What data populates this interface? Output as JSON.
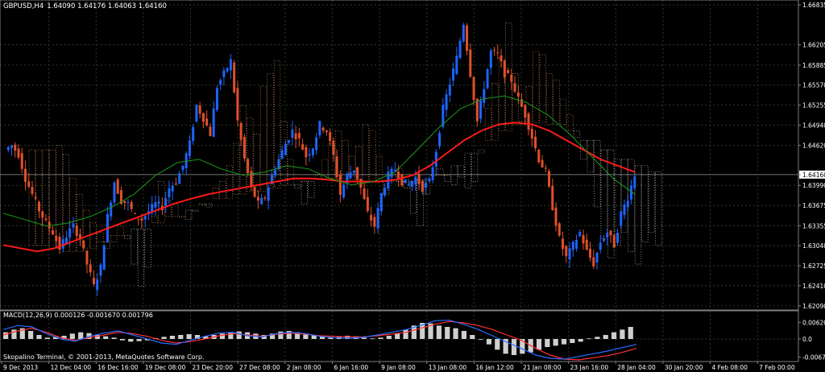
{
  "header": {
    "symbol": "GBPUSD,H4",
    "ohlc": "1.64090 1.64176 1.64063 1.64160"
  },
  "footer": {
    "copyright": "Skopalino Terminal, © 2001-2013, MetaQuotes Software Corp."
  },
  "colors": {
    "bull": "#1e64ff",
    "bear": "#e0502a",
    "ma_red": "#ff1a1a",
    "ma_green": "#1a9a1a",
    "cloud": "#e8a070",
    "cloud_alt": "#e6e6e6",
    "grid": "#2a3a2a",
    "macd_hist": "#cfcfcf",
    "macd_signal": "#ff3030",
    "macd_line": "#2a6cff"
  },
  "chart_data": [
    {
      "type": "candlestick",
      "title": "GBPUSD,H4",
      "ohlc_last": [
        1.6409,
        1.64176,
        1.64063,
        1.6416
      ],
      "current_price": "1.64160",
      "y_ticks": [
        "1.66835",
        "1.66205",
        "1.65885",
        "1.65570",
        "1.65255",
        "1.64940",
        "1.64620",
        "1.64160",
        "1.63990",
        "1.63675",
        "1.63355",
        "1.63040",
        "1.62725",
        "1.62410",
        "1.62090"
      ],
      "ylim": [
        1.6209,
        1.66835
      ],
      "x_ticks": [
        "9 Dec 2013",
        "12 Dec 04:00",
        "16 Dec 16:00",
        "19 Dec 08:00",
        "23 Dec 20:00",
        "27 Dec 08:00",
        "2 Jan 08:00",
        "6 Jan 16:00",
        "9 Jan 08:00",
        "13 Jan 08:00",
        "16 Jan 12:00",
        "21 Jan 08:00",
        "23 Jan 16:00",
        "28 Jan 04:00",
        "30 Jan 20:00",
        "4 Feb 08:00",
        "7 Feb 00:00"
      ],
      "series": [
        {
          "name": "close_path",
          "values": [
            1.6455,
            1.6462,
            1.6448,
            1.641,
            1.6385,
            1.636,
            1.634,
            1.6325,
            1.63,
            1.632,
            1.6335,
            1.6315,
            1.6275,
            1.624,
            1.627,
            1.635,
            1.6405,
            1.6375,
            1.637,
            1.635,
            1.6345,
            1.6358,
            1.637,
            1.6365,
            1.6395,
            1.6405,
            1.643,
            1.6465,
            1.6525,
            1.6505,
            1.648,
            1.6555,
            1.6575,
            1.6595,
            1.65,
            1.644,
            1.6395,
            1.637,
            1.638,
            1.6415,
            1.644,
            1.6465,
            1.6485,
            1.647,
            1.6445,
            1.646,
            1.6495,
            1.6485,
            1.6445,
            1.6385,
            1.6415,
            1.6425,
            1.6395,
            1.6355,
            1.6335,
            1.6385,
            1.6415,
            1.6425,
            1.6405,
            1.64,
            1.6412,
            1.6395,
            1.6405,
            1.6455,
            1.652,
            1.656,
            1.66,
            1.6655,
            1.6575,
            1.65,
            1.6555,
            1.661,
            1.6605,
            1.6575,
            1.6565,
            1.6535,
            1.651,
            1.6475,
            1.644,
            1.642,
            1.6365,
            1.6315,
            1.6285,
            1.6305,
            1.6325,
            1.6295,
            1.6275,
            1.631,
            1.6325,
            1.6305,
            1.6355,
            1.638,
            1.6416
          ]
        },
        {
          "name": "ma_red",
          "values": [
            1.6305,
            1.63,
            1.6295,
            1.63,
            1.631,
            1.632,
            1.633,
            1.634,
            1.635,
            1.636,
            1.637,
            1.6378,
            1.6385,
            1.639,
            1.6395,
            1.64,
            1.6405,
            1.641,
            1.641,
            1.6408,
            1.6405,
            1.6405,
            1.6405,
            1.6408,
            1.6415,
            1.643,
            1.645,
            1.647,
            1.6485,
            1.6495,
            1.6498,
            1.6495,
            1.6485,
            1.647,
            1.6455,
            1.644,
            1.643,
            1.642
          ]
        },
        {
          "name": "ma_green",
          "values": [
            1.6355,
            1.6345,
            1.6335,
            1.634,
            1.635,
            1.6365,
            1.6385,
            1.6415,
            1.6435,
            1.644,
            1.6425,
            1.6415,
            1.642,
            1.643,
            1.6425,
            1.641,
            1.64,
            1.6405,
            1.642,
            1.6455,
            1.649,
            1.652,
            1.6535,
            1.654,
            1.653,
            1.651,
            1.648,
            1.6445,
            1.641,
            1.6385
          ]
        }
      ]
    },
    {
      "type": "line",
      "title": "MACD(12,26,9) 0.000126 -0.001670 0.001796",
      "y_ticks": [
        "0.00620",
        "0.0",
        "-0.00675"
      ],
      "ylim": [
        -0.0075,
        0.0075
      ],
      "series": [
        {
          "name": "histogram",
          "values": [
            0.0025,
            0.0035,
            0.004,
            0.003,
            0.0015,
            0.0005,
            0.0008,
            0.0012,
            0.002,
            0.0025,
            0.0022,
            0.0015,
            0.001,
            0.0005,
            -0.0005,
            -0.001,
            -0.0008,
            -0.0005,
            0.0003,
            0.0008,
            0.0012,
            0.0015,
            0.0018,
            0.0015,
            0.001,
            0.0015,
            0.002,
            0.0025,
            0.0028,
            0.0025,
            0.002,
            0.0015,
            0.002,
            0.0028,
            0.003,
            0.0025,
            0.002,
            0.0015,
            0.001,
            0.0005,
            0.0008,
            0.0012,
            0.001,
            0.0005,
            0.0002,
            0.0005,
            0.0012,
            0.0022,
            0.0035,
            0.005,
            0.006,
            0.0058,
            0.005,
            0.0045,
            0.004,
            0.003,
            0.0015,
            0.0,
            -0.002,
            -0.004,
            -0.0055,
            -0.006,
            -0.0055,
            -0.005,
            -0.004,
            -0.003,
            -0.0025,
            -0.002,
            -0.0015,
            -0.001,
            0.0002,
            0.0008,
            0.0015,
            0.0025,
            0.0035,
            0.0045
          ]
        },
        {
          "name": "signal",
          "values": [
            0.0015,
            0.003,
            0.004,
            0.0025,
            0.0005,
            -0.0005,
            0.0005,
            0.0015,
            0.0025,
            0.002,
            0.001,
            -0.0005,
            -0.0015,
            -0.001,
            0.0,
            0.0012,
            0.002,
            0.0015,
            0.001,
            0.0018,
            0.0022,
            0.0018,
            0.0012,
            0.001,
            0.0008,
            0.0008,
            0.0012,
            0.0018,
            0.0025,
            0.004,
            0.0055,
            0.0065,
            0.006,
            0.005,
            0.0035,
            0.0015,
            -0.0005,
            -0.0035,
            -0.006,
            -0.0075,
            -0.0078,
            -0.007,
            -0.0062,
            -0.005,
            -0.0035
          ]
        },
        {
          "name": "macd",
          "values": [
            0.0035,
            0.005,
            0.0045,
            0.002,
            0.0,
            -0.0008,
            0.001,
            0.0022,
            0.003,
            0.0015,
            0.0,
            -0.0015,
            -0.002,
            -0.0005,
            0.001,
            0.0022,
            0.0025,
            0.0012,
            0.0008,
            0.002,
            0.0025,
            0.002,
            0.001,
            0.0005,
            0.0003,
            0.0006,
            0.0015,
            0.0025,
            0.0035,
            0.005,
            0.0068,
            0.007,
            0.0055,
            0.0035,
            0.0012,
            -0.0012,
            -0.0035,
            -0.006,
            -0.0072,
            -0.0075,
            -0.0065,
            -0.0055,
            -0.0045,
            -0.0032,
            -0.002
          ]
        }
      ]
    }
  ]
}
